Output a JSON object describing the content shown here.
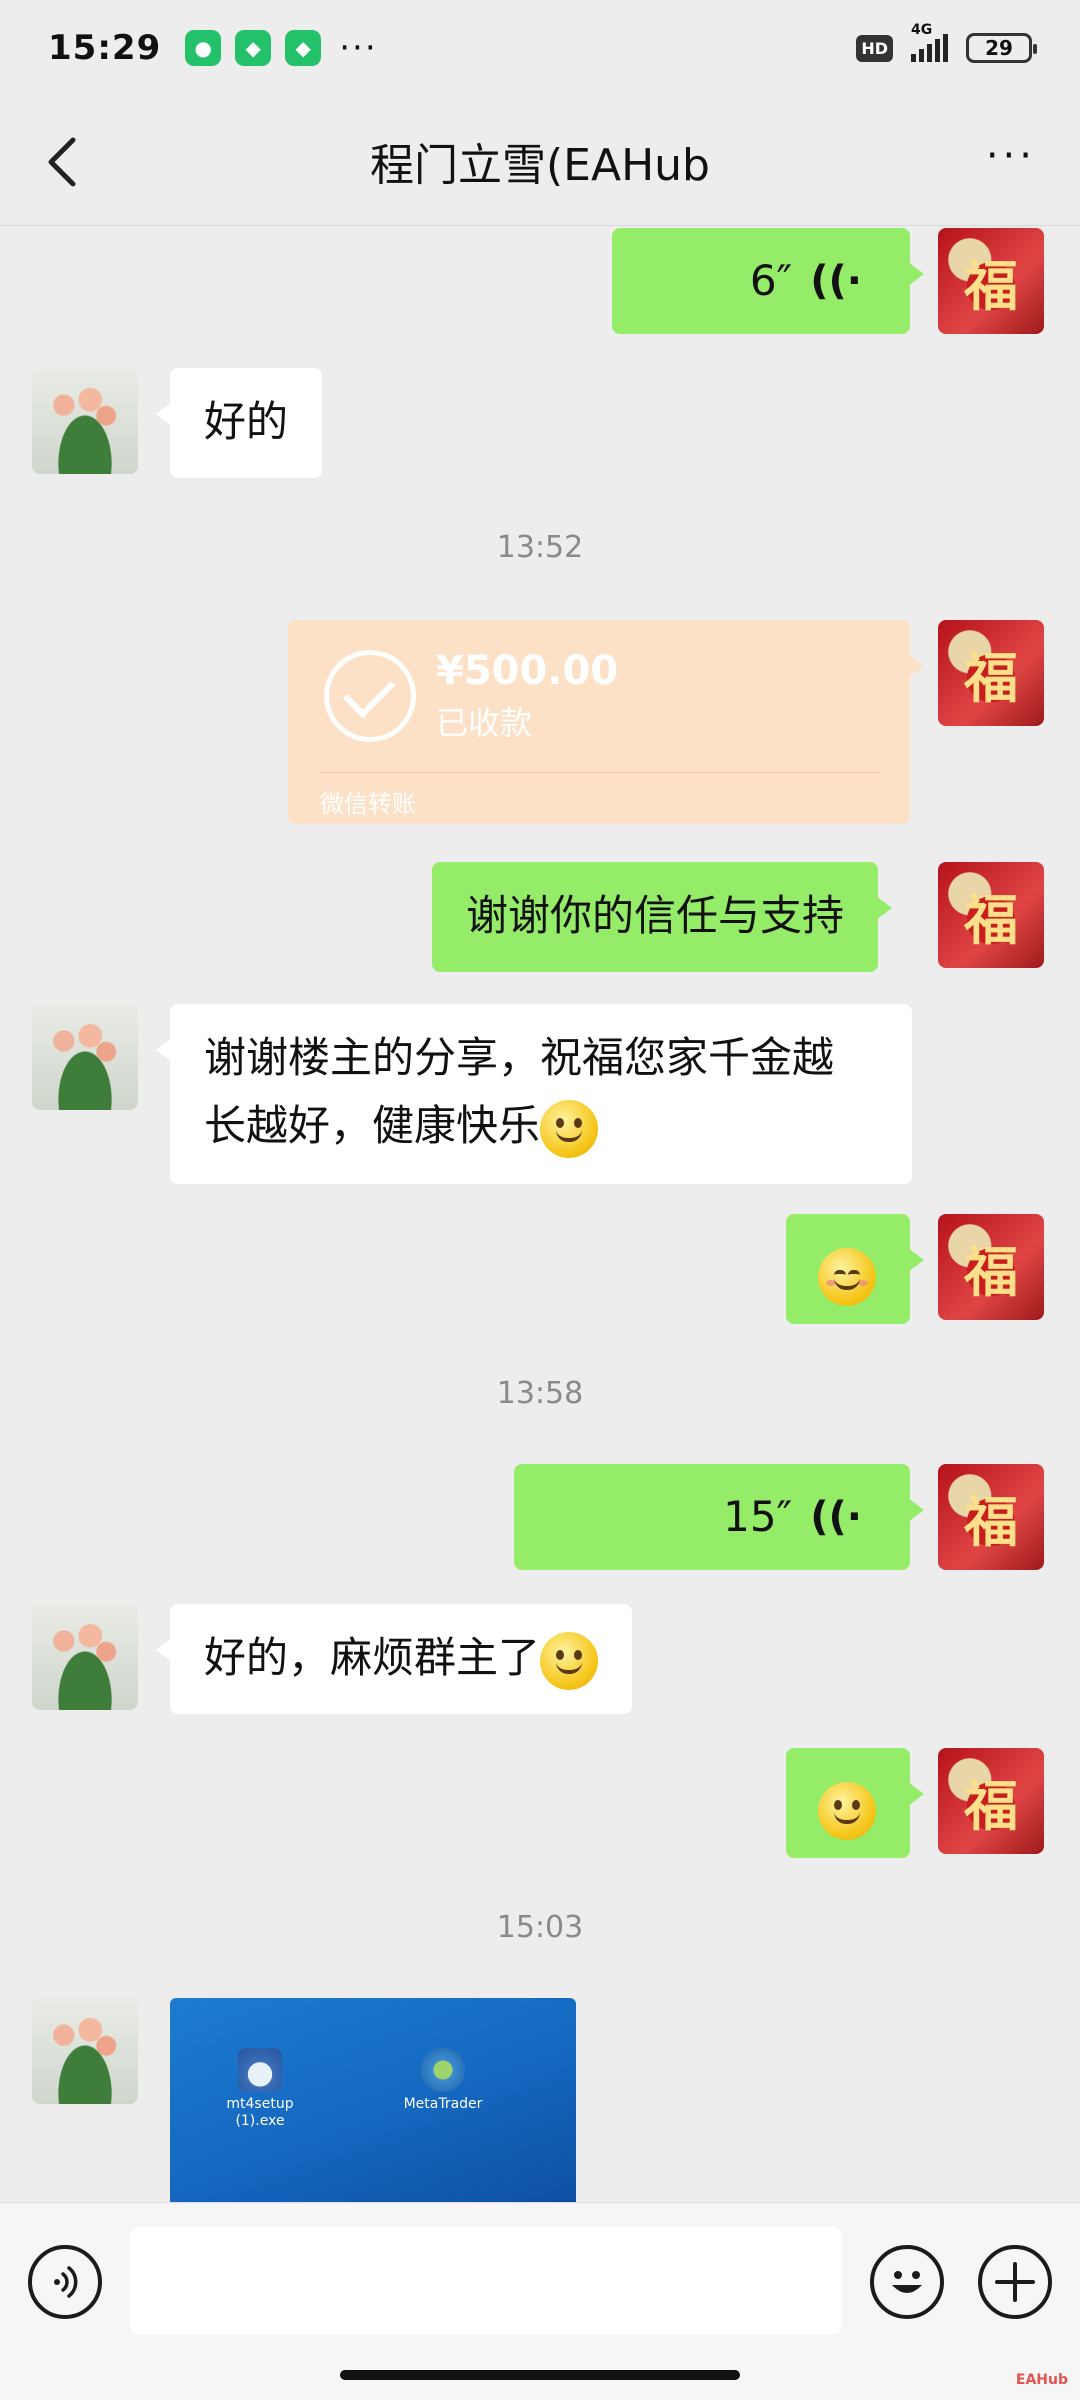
{
  "status_bar": {
    "time": "15:29",
    "more": "···",
    "hd": "HD",
    "network": "4G",
    "battery": "29"
  },
  "header": {
    "title": "程门立雪(EAHub",
    "more": "···"
  },
  "messages": {
    "voice1_duration": "6″",
    "reply1": "好的",
    "time1": "13:52",
    "transfer_amount": "¥500.00",
    "transfer_status": "已收款",
    "transfer_source": "微信转账",
    "thanks": "谢谢你的信任与支持",
    "wish_line1": "谢谢楼主的分享，祝福您家千金越",
    "wish_line2": "长越好，健康快乐",
    "time2": "13:58",
    "voice2_duration": "15″",
    "reply2": "好的，麻烦群主了",
    "time3": "15:03",
    "file_icon1": "mt4setup (1).exe",
    "file_icon2": "MetaTrader"
  },
  "input_bar": {
    "voice_icon": "voice-icon",
    "emoji_icon": "emoji-icon",
    "plus_icon": "plus-icon"
  },
  "watermark": "EAHub",
  "colors": {
    "bubble_me": "#95ec69",
    "bubble_other": "#ffffff",
    "transfer": "#fde1c7",
    "background": "#ededed"
  }
}
